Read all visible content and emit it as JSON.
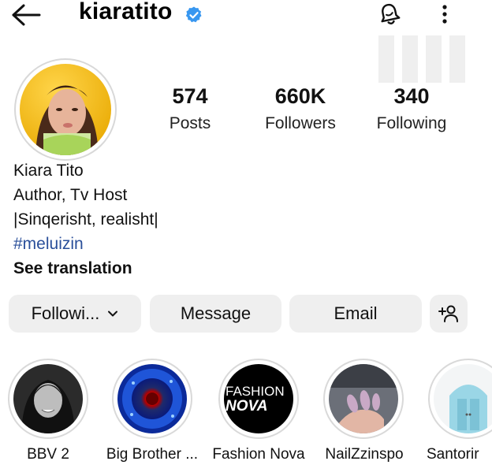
{
  "header": {
    "username": "kiaratito",
    "icons": [
      "back-arrow-icon",
      "verified-badge-icon",
      "notification-bell-icon",
      "more-vertical-icon"
    ]
  },
  "stats": [
    {
      "value": "574",
      "label": "Posts"
    },
    {
      "value": "660K",
      "label": "Followers"
    },
    {
      "value": "340",
      "label": "Following"
    }
  ],
  "bio": {
    "name": "Kiara Tito",
    "line1": "Author, Tv Host",
    "line2": "|Sinqerisht, realisht|",
    "hashtag": "#meluizin",
    "see_translation": "See translation"
  },
  "actions": {
    "following": "Followi...",
    "message": "Message",
    "email": "Email"
  },
  "highlights": [
    {
      "label": "BBV 2"
    },
    {
      "label": "Big Brother ..."
    },
    {
      "label": "Fashion Nova",
      "logo_text_1": "FASHION",
      "logo_text_2": "NOVA"
    },
    {
      "label": "NailZzinspo"
    },
    {
      "label": "Santorir"
    }
  ],
  "colors": {
    "verified": "#3897f0",
    "button_bg": "#efefef",
    "hashtag": "#2a4f9a"
  }
}
